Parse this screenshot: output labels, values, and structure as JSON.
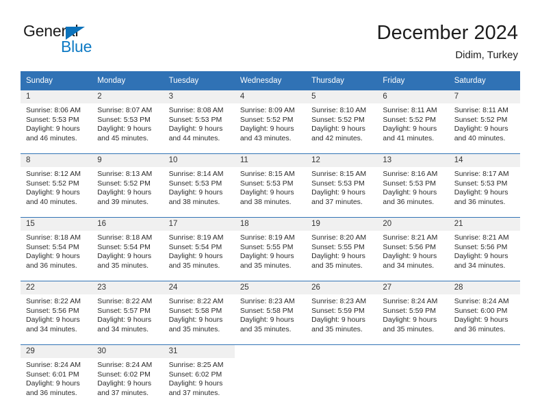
{
  "brand": {
    "name_part1": "General",
    "name_part2": "Blue",
    "logo_icon": "triangle-logo-icon"
  },
  "header": {
    "title": "December 2024",
    "location": "Didim, Turkey"
  },
  "calendar": {
    "weekday_headers": [
      "Sunday",
      "Monday",
      "Tuesday",
      "Wednesday",
      "Thursday",
      "Friday",
      "Saturday"
    ],
    "accent_color": "#3072b5",
    "daynum_band_color": "#f0f0f0",
    "weeks": [
      [
        {
          "day": "1",
          "sunrise": "Sunrise: 8:06 AM",
          "sunset": "Sunset: 5:53 PM",
          "daylight_line1": "Daylight: 9 hours",
          "daylight_line2": "and 46 minutes."
        },
        {
          "day": "2",
          "sunrise": "Sunrise: 8:07 AM",
          "sunset": "Sunset: 5:53 PM",
          "daylight_line1": "Daylight: 9 hours",
          "daylight_line2": "and 45 minutes."
        },
        {
          "day": "3",
          "sunrise": "Sunrise: 8:08 AM",
          "sunset": "Sunset: 5:53 PM",
          "daylight_line1": "Daylight: 9 hours",
          "daylight_line2": "and 44 minutes."
        },
        {
          "day": "4",
          "sunrise": "Sunrise: 8:09 AM",
          "sunset": "Sunset: 5:52 PM",
          "daylight_line1": "Daylight: 9 hours",
          "daylight_line2": "and 43 minutes."
        },
        {
          "day": "5",
          "sunrise": "Sunrise: 8:10 AM",
          "sunset": "Sunset: 5:52 PM",
          "daylight_line1": "Daylight: 9 hours",
          "daylight_line2": "and 42 minutes."
        },
        {
          "day": "6",
          "sunrise": "Sunrise: 8:11 AM",
          "sunset": "Sunset: 5:52 PM",
          "daylight_line1": "Daylight: 9 hours",
          "daylight_line2": "and 41 minutes."
        },
        {
          "day": "7",
          "sunrise": "Sunrise: 8:11 AM",
          "sunset": "Sunset: 5:52 PM",
          "daylight_line1": "Daylight: 9 hours",
          "daylight_line2": "and 40 minutes."
        }
      ],
      [
        {
          "day": "8",
          "sunrise": "Sunrise: 8:12 AM",
          "sunset": "Sunset: 5:52 PM",
          "daylight_line1": "Daylight: 9 hours",
          "daylight_line2": "and 40 minutes."
        },
        {
          "day": "9",
          "sunrise": "Sunrise: 8:13 AM",
          "sunset": "Sunset: 5:52 PM",
          "daylight_line1": "Daylight: 9 hours",
          "daylight_line2": "and 39 minutes."
        },
        {
          "day": "10",
          "sunrise": "Sunrise: 8:14 AM",
          "sunset": "Sunset: 5:53 PM",
          "daylight_line1": "Daylight: 9 hours",
          "daylight_line2": "and 38 minutes."
        },
        {
          "day": "11",
          "sunrise": "Sunrise: 8:15 AM",
          "sunset": "Sunset: 5:53 PM",
          "daylight_line1": "Daylight: 9 hours",
          "daylight_line2": "and 38 minutes."
        },
        {
          "day": "12",
          "sunrise": "Sunrise: 8:15 AM",
          "sunset": "Sunset: 5:53 PM",
          "daylight_line1": "Daylight: 9 hours",
          "daylight_line2": "and 37 minutes."
        },
        {
          "day": "13",
          "sunrise": "Sunrise: 8:16 AM",
          "sunset": "Sunset: 5:53 PM",
          "daylight_line1": "Daylight: 9 hours",
          "daylight_line2": "and 36 minutes."
        },
        {
          "day": "14",
          "sunrise": "Sunrise: 8:17 AM",
          "sunset": "Sunset: 5:53 PM",
          "daylight_line1": "Daylight: 9 hours",
          "daylight_line2": "and 36 minutes."
        }
      ],
      [
        {
          "day": "15",
          "sunrise": "Sunrise: 8:18 AM",
          "sunset": "Sunset: 5:54 PM",
          "daylight_line1": "Daylight: 9 hours",
          "daylight_line2": "and 36 minutes."
        },
        {
          "day": "16",
          "sunrise": "Sunrise: 8:18 AM",
          "sunset": "Sunset: 5:54 PM",
          "daylight_line1": "Daylight: 9 hours",
          "daylight_line2": "and 35 minutes."
        },
        {
          "day": "17",
          "sunrise": "Sunrise: 8:19 AM",
          "sunset": "Sunset: 5:54 PM",
          "daylight_line1": "Daylight: 9 hours",
          "daylight_line2": "and 35 minutes."
        },
        {
          "day": "18",
          "sunrise": "Sunrise: 8:19 AM",
          "sunset": "Sunset: 5:55 PM",
          "daylight_line1": "Daylight: 9 hours",
          "daylight_line2": "and 35 minutes."
        },
        {
          "day": "19",
          "sunrise": "Sunrise: 8:20 AM",
          "sunset": "Sunset: 5:55 PM",
          "daylight_line1": "Daylight: 9 hours",
          "daylight_line2": "and 35 minutes."
        },
        {
          "day": "20",
          "sunrise": "Sunrise: 8:21 AM",
          "sunset": "Sunset: 5:56 PM",
          "daylight_line1": "Daylight: 9 hours",
          "daylight_line2": "and 34 minutes."
        },
        {
          "day": "21",
          "sunrise": "Sunrise: 8:21 AM",
          "sunset": "Sunset: 5:56 PM",
          "daylight_line1": "Daylight: 9 hours",
          "daylight_line2": "and 34 minutes."
        }
      ],
      [
        {
          "day": "22",
          "sunrise": "Sunrise: 8:22 AM",
          "sunset": "Sunset: 5:56 PM",
          "daylight_line1": "Daylight: 9 hours",
          "daylight_line2": "and 34 minutes."
        },
        {
          "day": "23",
          "sunrise": "Sunrise: 8:22 AM",
          "sunset": "Sunset: 5:57 PM",
          "daylight_line1": "Daylight: 9 hours",
          "daylight_line2": "and 34 minutes."
        },
        {
          "day": "24",
          "sunrise": "Sunrise: 8:22 AM",
          "sunset": "Sunset: 5:58 PM",
          "daylight_line1": "Daylight: 9 hours",
          "daylight_line2": "and 35 minutes."
        },
        {
          "day": "25",
          "sunrise": "Sunrise: 8:23 AM",
          "sunset": "Sunset: 5:58 PM",
          "daylight_line1": "Daylight: 9 hours",
          "daylight_line2": "and 35 minutes."
        },
        {
          "day": "26",
          "sunrise": "Sunrise: 8:23 AM",
          "sunset": "Sunset: 5:59 PM",
          "daylight_line1": "Daylight: 9 hours",
          "daylight_line2": "and 35 minutes."
        },
        {
          "day": "27",
          "sunrise": "Sunrise: 8:24 AM",
          "sunset": "Sunset: 5:59 PM",
          "daylight_line1": "Daylight: 9 hours",
          "daylight_line2": "and 35 minutes."
        },
        {
          "day": "28",
          "sunrise": "Sunrise: 8:24 AM",
          "sunset": "Sunset: 6:00 PM",
          "daylight_line1": "Daylight: 9 hours",
          "daylight_line2": "and 36 minutes."
        }
      ],
      [
        {
          "day": "29",
          "sunrise": "Sunrise: 8:24 AM",
          "sunset": "Sunset: 6:01 PM",
          "daylight_line1": "Daylight: 9 hours",
          "daylight_line2": "and 36 minutes."
        },
        {
          "day": "30",
          "sunrise": "Sunrise: 8:24 AM",
          "sunset": "Sunset: 6:02 PM",
          "daylight_line1": "Daylight: 9 hours",
          "daylight_line2": "and 37 minutes."
        },
        {
          "day": "31",
          "sunrise": "Sunrise: 8:25 AM",
          "sunset": "Sunset: 6:02 PM",
          "daylight_line1": "Daylight: 9 hours",
          "daylight_line2": "and 37 minutes."
        },
        {
          "day": "",
          "sunrise": "",
          "sunset": "",
          "daylight_line1": "",
          "daylight_line2": ""
        },
        {
          "day": "",
          "sunrise": "",
          "sunset": "",
          "daylight_line1": "",
          "daylight_line2": ""
        },
        {
          "day": "",
          "sunrise": "",
          "sunset": "",
          "daylight_line1": "",
          "daylight_line2": ""
        },
        {
          "day": "",
          "sunrise": "",
          "sunset": "",
          "daylight_line1": "",
          "daylight_line2": ""
        }
      ]
    ]
  }
}
